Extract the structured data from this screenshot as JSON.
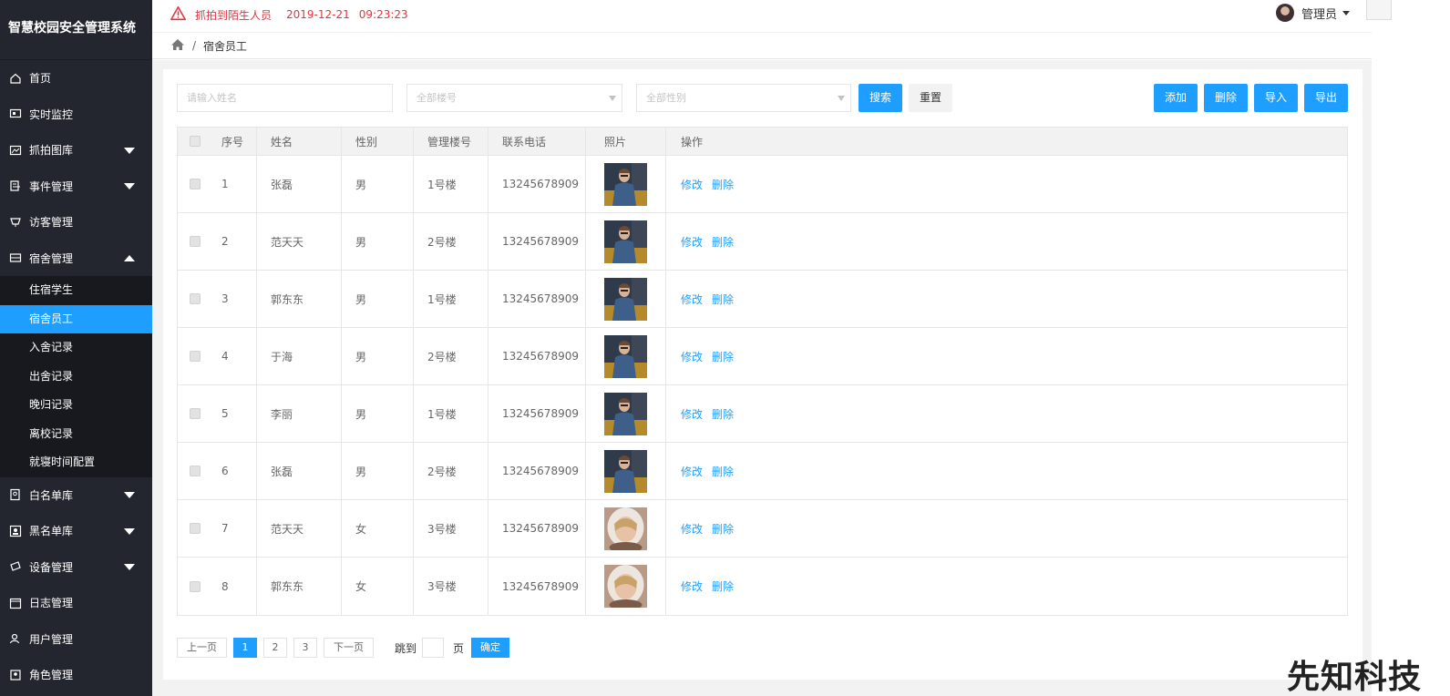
{
  "app": {
    "title": "智慧校园安全管理系统"
  },
  "sidebar": {
    "items": [
      {
        "label": "首页",
        "icon": "home-icon",
        "arrow": ""
      },
      {
        "label": "实时监控",
        "icon": "monitor-icon",
        "arrow": ""
      },
      {
        "label": "抓拍图库",
        "icon": "image-icon",
        "arrow": "down"
      },
      {
        "label": "事件管理",
        "icon": "event-icon",
        "arrow": "down"
      },
      {
        "label": "访客管理",
        "icon": "cup-icon",
        "arrow": ""
      },
      {
        "label": "宿舍管理",
        "icon": "dorm-icon",
        "arrow": "up"
      }
    ],
    "submenu": [
      {
        "label": "住宿学生",
        "active": false
      },
      {
        "label": "宿舍员工",
        "active": true
      },
      {
        "label": "入舍记录",
        "active": false
      },
      {
        "label": "出舍记录",
        "active": false
      },
      {
        "label": "晚归记录",
        "active": false
      },
      {
        "label": "离校记录",
        "active": false
      },
      {
        "label": "就寝时间配置",
        "active": false
      }
    ],
    "items_after": [
      {
        "label": "白名单库",
        "icon": "whitelist-icon",
        "arrow": "down"
      },
      {
        "label": "黑名单库",
        "icon": "blacklist-icon",
        "arrow": "down"
      },
      {
        "label": "设备管理",
        "icon": "device-icon",
        "arrow": "down"
      },
      {
        "label": "日志管理",
        "icon": "log-icon",
        "arrow": ""
      },
      {
        "label": "用户管理",
        "icon": "user-icon",
        "arrow": ""
      },
      {
        "label": "角色管理",
        "icon": "role-icon",
        "arrow": ""
      }
    ]
  },
  "topbar": {
    "alert_text": "抓拍到陌生人员",
    "alert_date": "2019-12-21",
    "alert_time": "09:23:23",
    "alert_color": "#e8323e",
    "user_name": "管理员"
  },
  "breadcrumb": {
    "current": "宿舍员工",
    "separator": "/"
  },
  "filters": {
    "name_placeholder": "请输入姓名",
    "building_placeholder": "全部楼号",
    "gender_placeholder": "全部性别",
    "search_label": "搜索",
    "reset_label": "重置"
  },
  "actions": {
    "add": "添加",
    "delete": "删除",
    "import": "导入",
    "export": "导出"
  },
  "table": {
    "headers": [
      "序号",
      "姓名",
      "性别",
      "管理楼号",
      "联系电话",
      "照片",
      "操作"
    ],
    "edit_label": "修改",
    "delete_label": "删除",
    "rows": [
      {
        "no": "1",
        "name": "张磊",
        "gender": "男",
        "building": "1号楼",
        "phone": "13245678909",
        "photo": "male"
      },
      {
        "no": "2",
        "name": "范天天",
        "gender": "男",
        "building": "2号楼",
        "phone": "13245678909",
        "photo": "male"
      },
      {
        "no": "3",
        "name": "郭东东",
        "gender": "男",
        "building": "1号楼",
        "phone": "13245678909",
        "photo": "male"
      },
      {
        "no": "4",
        "name": "于海",
        "gender": "男",
        "building": "2号楼",
        "phone": "13245678909",
        "photo": "male"
      },
      {
        "no": "5",
        "name": "李丽",
        "gender": "男",
        "building": "1号楼",
        "phone": "13245678909",
        "photo": "male"
      },
      {
        "no": "6",
        "name": "张磊",
        "gender": "男",
        "building": "2号楼",
        "phone": "13245678909",
        "photo": "male"
      },
      {
        "no": "7",
        "name": "范天天",
        "gender": "女",
        "building": "3号楼",
        "phone": "13245678909",
        "photo": "female"
      },
      {
        "no": "8",
        "name": "郭东东",
        "gender": "女",
        "building": "3号楼",
        "phone": "13245678909",
        "photo": "female"
      }
    ]
  },
  "pagination": {
    "prev": "上一页",
    "pages": [
      "1",
      "2",
      "3"
    ],
    "current": "1",
    "next": "下一页",
    "jump_label": "跳到",
    "page_unit": "页",
    "confirm": "确定"
  },
  "watermark": "先知科技",
  "colors": {
    "sidebar_bg": "#23262e",
    "accent": "#1e9fff",
    "submenu_bg": "#17191e"
  }
}
